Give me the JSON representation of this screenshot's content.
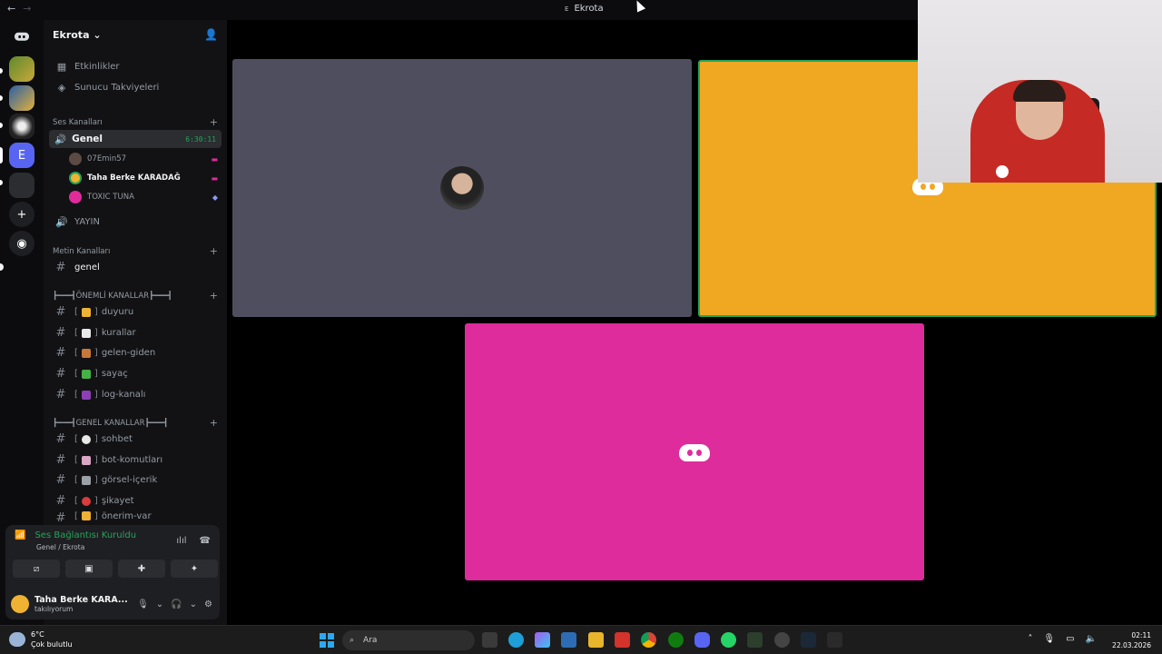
{
  "window": {
    "title": "Ekrota",
    "title_icon": "E",
    "back": "←",
    "forward": "→"
  },
  "server": {
    "name": "Ekrota",
    "chevron": "⌄"
  },
  "sidebar": {
    "top_items": [
      {
        "label": "Etkinlikler",
        "icon": "calendar-icon"
      },
      {
        "label": "Sunucu Takviyeleri",
        "icon": "boost-icon"
      }
    ],
    "voice_category": "Ses Kanalları",
    "voice_channel": {
      "name": "Genel",
      "timer": "6:30:11"
    },
    "voice_users": [
      {
        "name": "07Emin57",
        "color": "#5c4a44"
      },
      {
        "name": "Taha Berke KARADAĞ",
        "color": "#f0b232"
      },
      {
        "name": "TOXIC TUNA",
        "color": "#e02c9a"
      }
    ],
    "voice_channel_2": "YAYIN",
    "text_category": "Metin Kanalları",
    "text_channel": "genel",
    "important_category": "┣━━━┫ÖNEMLİ KANALLAR┣━━━┫",
    "important_channels": [
      {
        "name": "duyuru",
        "emoji_color": "#f0b232"
      },
      {
        "name": "kurallar",
        "emoji_color": "#e8e8e8"
      },
      {
        "name": "gelen-giden",
        "emoji_color": "#c7793a"
      },
      {
        "name": "sayaç",
        "emoji_color": "#46b146"
      },
      {
        "name": "log-kanalı",
        "emoji_color": "#8c3fb5"
      }
    ],
    "general_category": "┣━━━┫GENEL KANALLAR┣━━━┫",
    "general_channels": [
      {
        "name": "sohbet",
        "emoji_color": "#e8e8e8"
      },
      {
        "name": "bot-komutları",
        "emoji_color": "#d9a6c4"
      },
      {
        "name": "görsel-içerik",
        "emoji_color": "#9aa0a6"
      },
      {
        "name": "şikayet",
        "emoji_color": "#d83c3e"
      },
      {
        "name": "önerim-var",
        "emoji_color": "#f0b232"
      }
    ],
    "bracket_open": "[",
    "bracket_close": "]"
  },
  "voice_panel": {
    "status": "Ses Bağlantısı Kuruldu",
    "sub": "Genel / Ekrota"
  },
  "user": {
    "name": "Taha Berke KARA...",
    "status": "takılıyorum"
  },
  "tiles": [
    {
      "color": "#4e4e5e"
    },
    {
      "color": "#f0a823"
    },
    {
      "color": "#de2c9c"
    }
  ],
  "taskbar": {
    "temp": "6°C",
    "weather": "Çok bulutlu",
    "search_placeholder": "Ara",
    "time": "02:11",
    "date": "22.03.2026"
  },
  "colors": {
    "green": "#23a55a",
    "bg": "#121214"
  }
}
